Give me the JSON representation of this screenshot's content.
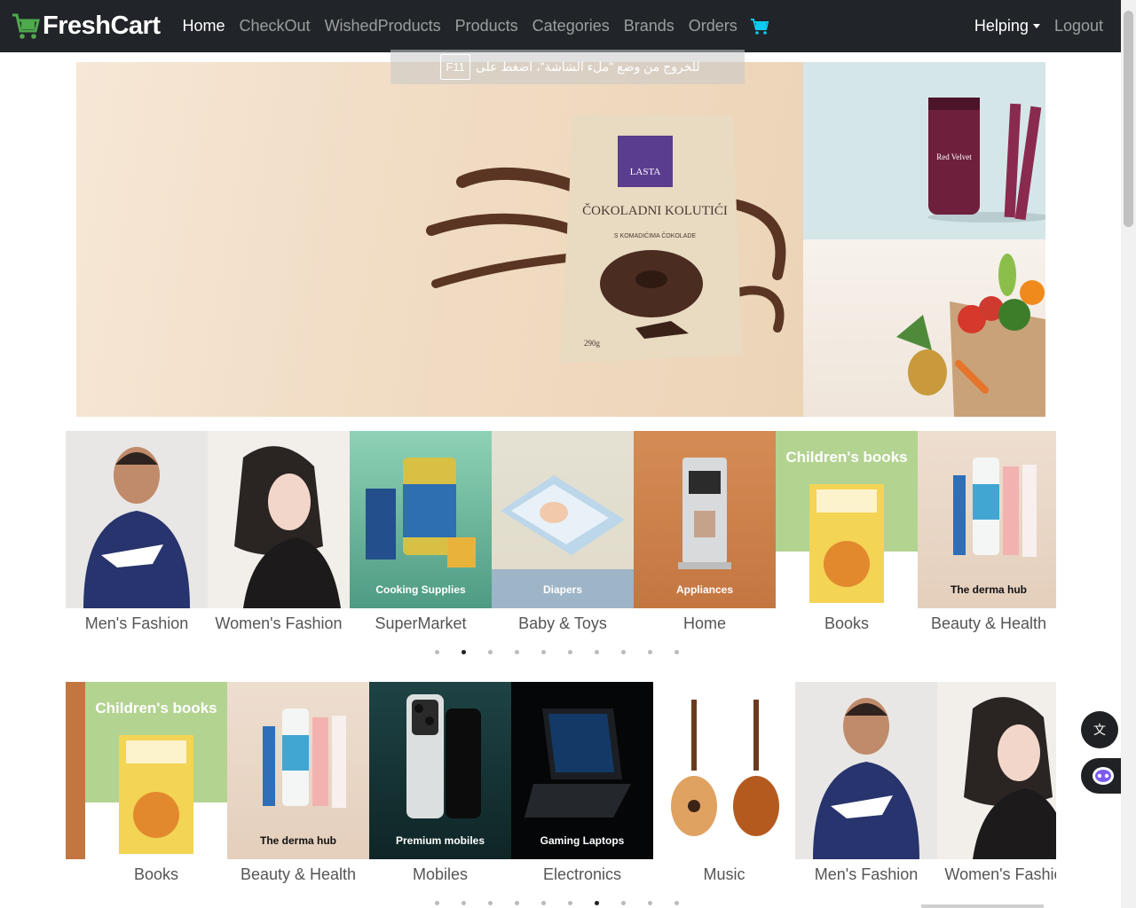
{
  "brand": {
    "name": "FreshCart"
  },
  "nav": {
    "links": [
      "Home",
      "CheckOut",
      "WishedProducts",
      "Products",
      "Categories",
      "Brands",
      "Orders"
    ],
    "active": "Home",
    "helping": "Helping",
    "logout": "Logout"
  },
  "fullscreen_notice": {
    "before": "للخروج من وضع \"ملء الشاشة\"، اضغط على",
    "key": "F11"
  },
  "banner": {
    "product_brand": "LASTA",
    "product_name": "ČOKOLADNI KOLUTIĆI",
    "product_sub": "S KOMADIĆIMA ČOKOLADE",
    "product_weight": "290g",
    "side_top_product": "Red Velvet"
  },
  "categories_row1": [
    {
      "name": "Men's Fashion",
      "caption": ""
    },
    {
      "name": "Women's Fashion",
      "caption": ""
    },
    {
      "name": "SuperMarket",
      "caption": "Cooking Supplies"
    },
    {
      "name": "Baby & Toys",
      "caption": "Diapers"
    },
    {
      "name": "Home",
      "caption": "Appliances"
    },
    {
      "name": "Books",
      "caption": "Children's books"
    },
    {
      "name": "Beauty & Health",
      "caption": "The derma hub"
    }
  ],
  "categories_row2": [
    {
      "name": "Books",
      "caption": "Children's books"
    },
    {
      "name": "Beauty & Health",
      "caption": "The derma hub"
    },
    {
      "name": "Mobiles",
      "caption": "Premium mobiles"
    },
    {
      "name": "Electronics",
      "caption": "Gaming Laptops"
    },
    {
      "name": "Music",
      "caption": ""
    },
    {
      "name": "Men's Fashion",
      "caption": ""
    },
    {
      "name": "Women's Fashion",
      "caption": ""
    }
  ],
  "slider1": {
    "dot_count": 10,
    "active_index": 1
  },
  "slider2": {
    "dot_count": 10,
    "active_index": 6
  },
  "colors": {
    "navbar": "#212529",
    "brand_green": "#4fa94d",
    "cart": "#0dcaf0"
  },
  "icons": [
    "cart-logo-icon",
    "shopping-cart-icon",
    "translate-icon",
    "assistant-icon"
  ]
}
